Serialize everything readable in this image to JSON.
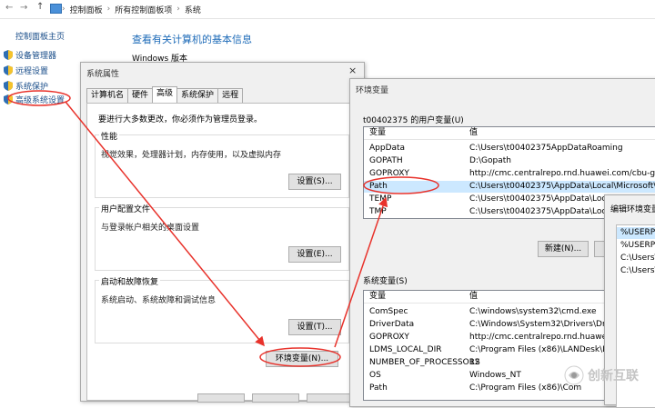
{
  "addressbar": {
    "back": "←",
    "forward": "→",
    "up": "↑",
    "crumbs": [
      "控制面板",
      "所有控制面板项",
      "系统"
    ]
  },
  "leftpanel": {
    "home": "控制面板主页",
    "items": [
      "设备管理器",
      "远程设置",
      "系统保护",
      "高级系统设置"
    ]
  },
  "main": {
    "heading": "查看有关计算机的基本信息",
    "windows_edition": "Windows 版本"
  },
  "sysprops": {
    "title": "系统属性",
    "close": "×",
    "tabs": [
      "计算机名",
      "硬件",
      "高级",
      "系统保护",
      "远程"
    ],
    "active_tab": "高级",
    "admin_note": "要进行大多数更改，你必须作为管理员登录。",
    "groups": [
      {
        "title": "性能",
        "desc": "视觉效果，处理器计划，内存使用，以及虚拟内存",
        "button": "设置(S)..."
      },
      {
        "title": "用户配置文件",
        "desc": "与登录帐户相关的桌面设置",
        "button": "设置(E)..."
      },
      {
        "title": "启动和故障恢复",
        "desc": "系统启动、系统故障和调试信息",
        "button": "设置(T)..."
      }
    ],
    "env_button": "环境变量(N)..."
  },
  "envvars": {
    "title": "环境变量",
    "close": "×",
    "user_section": "t00402375 的用户变量(U)",
    "col_var": "变量",
    "col_val": "值",
    "user_rows": [
      {
        "name": "AppData",
        "value": "C:\\Users\\t00402375AppDataRoaming"
      },
      {
        "name": "GOPATH",
        "value": "D:\\Gopath"
      },
      {
        "name": "GOPROXY",
        "value": "http://cmc.centralrepo.rnd.huawei.com/cbu-go"
      },
      {
        "name": "Path",
        "value": "C:\\Users\\t00402375\\AppData\\Local\\Microsoft\\Windov"
      },
      {
        "name": "TEMP",
        "value": "C:\\Users\\t00402375\\AppData\\Local\\Te"
      },
      {
        "name": "TMP",
        "value": "C:\\Users\\t00402375\\AppData\\Local\\Te"
      }
    ],
    "new_button": "新建(N)...",
    "sys_section": "系统变量(S)",
    "sys_rows": [
      {
        "name": "ComSpec",
        "value": "C:\\windows\\system32\\cmd.exe"
      },
      {
        "name": "DriverData",
        "value": "C:\\Windows\\System32\\Drivers\\DriverDa"
      },
      {
        "name": "GOPROXY",
        "value": "http://cmc.centralrepo.rnd.huawei.com/cb"
      },
      {
        "name": "LDMS_LOCAL_DIR",
        "value": "C:\\Program Files (x86)\\LANDesk\\LDClie"
      },
      {
        "name": "NUMBER_OF_PROCESSORS",
        "value": "12"
      },
      {
        "name": "OS",
        "value": "Windows_NT"
      },
      {
        "name": "Path",
        "value": "C:\\Program Files (x86)\\Com"
      }
    ]
  },
  "editenv": {
    "title": "编辑环境变量",
    "rows": [
      "%USERPR",
      "%USERPR",
      "C:\\Users\\t",
      "C:\\Users\\t"
    ]
  },
  "watermark": {
    "text": "创新互联"
  },
  "colors": {
    "annotation_red": "#e8322b",
    "link_blue": "#1a4e8a",
    "heading_blue": "#1e6bb8",
    "selection_blue": "#cce8ff"
  }
}
